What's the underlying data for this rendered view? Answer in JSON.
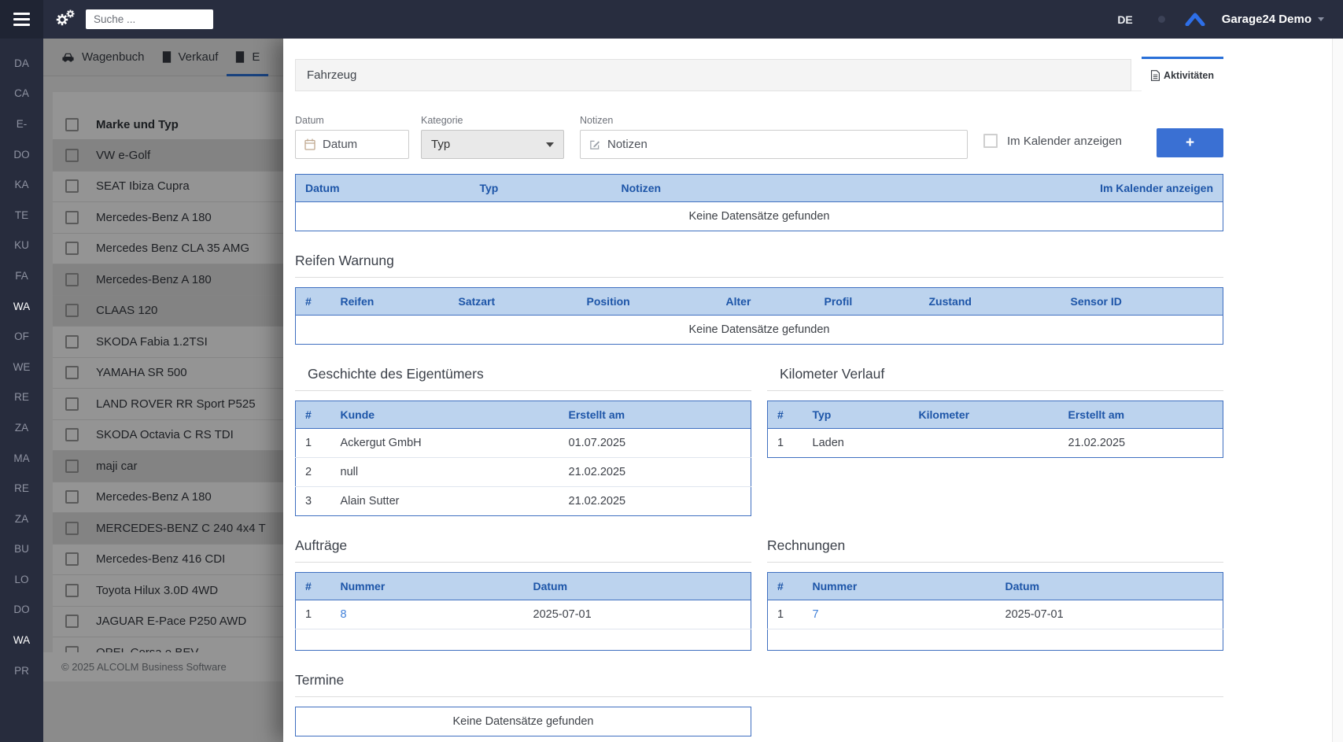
{
  "navbar": {
    "search_placeholder": "Suche ...",
    "language": "DE",
    "account_name": "Garage24 Demo"
  },
  "icons": {
    "gears": "two-cogs",
    "brand_logo": "blue-chevron",
    "wagenbuch": "car",
    "verkauf": "building",
    "aktivitaeten": "document",
    "datum": "calendar",
    "notizen": "pencil"
  },
  "sidebar": {
    "items": [
      {
        "label": "DA",
        "active": false
      },
      {
        "label": "CA",
        "active": false
      },
      {
        "label": "E-",
        "active": false
      },
      {
        "label": "DO",
        "active": false
      },
      {
        "label": "KA",
        "active": false
      },
      {
        "label": "TE",
        "active": false
      },
      {
        "label": "KU",
        "active": false
      },
      {
        "label": "FA",
        "active": false
      },
      {
        "label": "WA",
        "active": true
      },
      {
        "label": "OF",
        "active": false
      },
      {
        "label": "WE",
        "active": false
      },
      {
        "label": "RE",
        "active": false
      },
      {
        "label": "ZA",
        "active": false
      },
      {
        "label": "MA",
        "active": false
      },
      {
        "label": "RE",
        "active": false
      },
      {
        "label": "ZA",
        "active": false
      },
      {
        "label": "BU",
        "active": false
      },
      {
        "label": "LO",
        "active": false
      },
      {
        "label": "DO",
        "active": false
      },
      {
        "label": "WA",
        "active": true
      },
      {
        "label": "PR",
        "active": false
      }
    ]
  },
  "background": {
    "tabs": [
      {
        "label": "Wagenbuch"
      },
      {
        "label": "Verkauf"
      },
      {
        "label": "E"
      }
    ],
    "list_header": "Marke und Typ",
    "vehicles": [
      {
        "label": "VW e-Golf",
        "selected": true
      },
      {
        "label": "SEAT Ibiza Cupra",
        "selected": false
      },
      {
        "label": "Mercedes-Benz A 180",
        "selected": false
      },
      {
        "label": "Mercedes Benz CLA 35 AMG",
        "selected": false
      },
      {
        "label": "Mercedes-Benz A 180",
        "selected": true
      },
      {
        "label": "CLAAS 120",
        "selected": true
      },
      {
        "label": "SKODA Fabia 1.2TSI",
        "selected": false
      },
      {
        "label": "YAMAHA SR 500",
        "selected": false
      },
      {
        "label": "LAND ROVER RR Sport P525",
        "selected": false
      },
      {
        "label": "SKODA Octavia C RS TDI",
        "selected": false
      },
      {
        "label": "maji car",
        "selected": true
      },
      {
        "label": "Mercedes-Benz A 180",
        "selected": false
      },
      {
        "label": "MERCEDES-BENZ C 240 4x4 T",
        "selected": true
      },
      {
        "label": "Mercedes-Benz 416 CDI",
        "selected": false
      },
      {
        "label": "Toyota Hilux 3.0D 4WD",
        "selected": false
      },
      {
        "label": "JAGUAR E-Pace P250 AWD",
        "selected": false
      },
      {
        "label": "OPEL Corsa e BEV",
        "selected": false
      }
    ],
    "footer": "© 2025 ALCOLM Business Software"
  },
  "panel": {
    "tab_fahrzeug": "Fahrzeug",
    "tab_aktivitaeten": "Aktivitäten",
    "form": {
      "datum_label": "Datum",
      "datum_placeholder": "Datum",
      "kategorie_label": "Kategorie",
      "kategorie_value": "Typ",
      "notizen_label": "Notizen",
      "notizen_placeholder": "Notizen",
      "kalender_label": "Im Kalender anzeigen",
      "add_button": "+"
    },
    "aktivitaeten_table": {
      "columns": [
        "Datum",
        "Typ",
        "Notizen",
        "Im Kalender anzeigen"
      ],
      "empty": "Keine Datensätze gefunden"
    },
    "reifen": {
      "title": "Reifen Warnung",
      "columns": [
        "#",
        "Reifen",
        "Satzart",
        "Position",
        "Alter",
        "Profil",
        "Zustand",
        "Sensor ID"
      ],
      "empty": "Keine Datensätze gefunden"
    },
    "eigentuemer": {
      "title": "Geschichte des Eigentümers",
      "columns": [
        "#",
        "Kunde",
        "Erstellt am"
      ],
      "rows": [
        [
          "1",
          "Ackergut GmbH",
          "01.07.2025"
        ],
        [
          "2",
          "null",
          "21.02.2025"
        ],
        [
          "3",
          "Alain Sutter",
          "21.02.2025"
        ]
      ]
    },
    "kilometer": {
      "title": "Kilometer Verlauf",
      "columns": [
        "#",
        "Typ",
        "Kilometer",
        "Erstellt am"
      ],
      "rows": [
        [
          "1",
          "Laden",
          "",
          "21.02.2025"
        ]
      ]
    },
    "auftraege": {
      "title": "Aufträge",
      "columns": [
        "#",
        "Nummer",
        "Datum"
      ],
      "link_col": 1,
      "rows": [
        [
          "1",
          "8",
          "2025-07-01"
        ]
      ]
    },
    "rechnungen": {
      "title": "Rechnungen",
      "columns": [
        "#",
        "Nummer",
        "Datum"
      ],
      "link_col": 1,
      "rows": [
        [
          "1",
          "7",
          "2025-07-01"
        ]
      ]
    },
    "termine": {
      "title": "Termine",
      "empty": "Keine Datensätze gefunden"
    }
  },
  "colors": {
    "navbar_bg": "#282d3f",
    "sidebar_bg": "#272c3d",
    "accent_blue": "#3a70d3",
    "active_tab_border": "#2a70d8",
    "table_header_bg": "#bcd3ee",
    "table_header_text": "#1d55a8",
    "table_border": "#3f6fc0",
    "link_blue": "#4181d9",
    "logo_blue": "#2e6fe8"
  }
}
